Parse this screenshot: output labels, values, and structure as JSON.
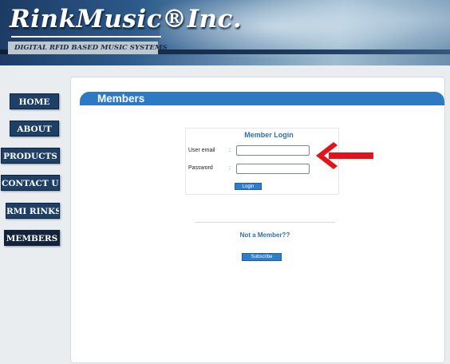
{
  "header": {
    "logo_text": "RinkMusic®Inc.",
    "tagline": "DIGITAL RFID BASED MUSIC SYSTEMS"
  },
  "nav": {
    "items": [
      {
        "label": "HOME",
        "active": false
      },
      {
        "label": "ABOUT",
        "active": false
      },
      {
        "label": "PRODUCTS",
        "active": false
      },
      {
        "label": "CONTACT US",
        "active": false
      },
      {
        "label": "RMI RINKS",
        "active": false
      },
      {
        "label": "MEMBERS",
        "active": true
      }
    ]
  },
  "main": {
    "section_title": "Members",
    "login": {
      "title": "Member Login",
      "email_label": "User email",
      "email_value": "",
      "password_label": "Password",
      "password_value": "",
      "colon": ":",
      "button_label": "Login"
    },
    "not_member_text": "Not a Member??",
    "subscribe_label": "Subscribe"
  },
  "colors": {
    "nav_bg": "#1e3f66",
    "section_bar": "#2e79c3",
    "link_blue": "#2f6db5",
    "button_blue": "#2e7ed0",
    "annotation_arrow": "#e2131a"
  },
  "annotation": {
    "icon": "red-arrow-left-icon"
  }
}
